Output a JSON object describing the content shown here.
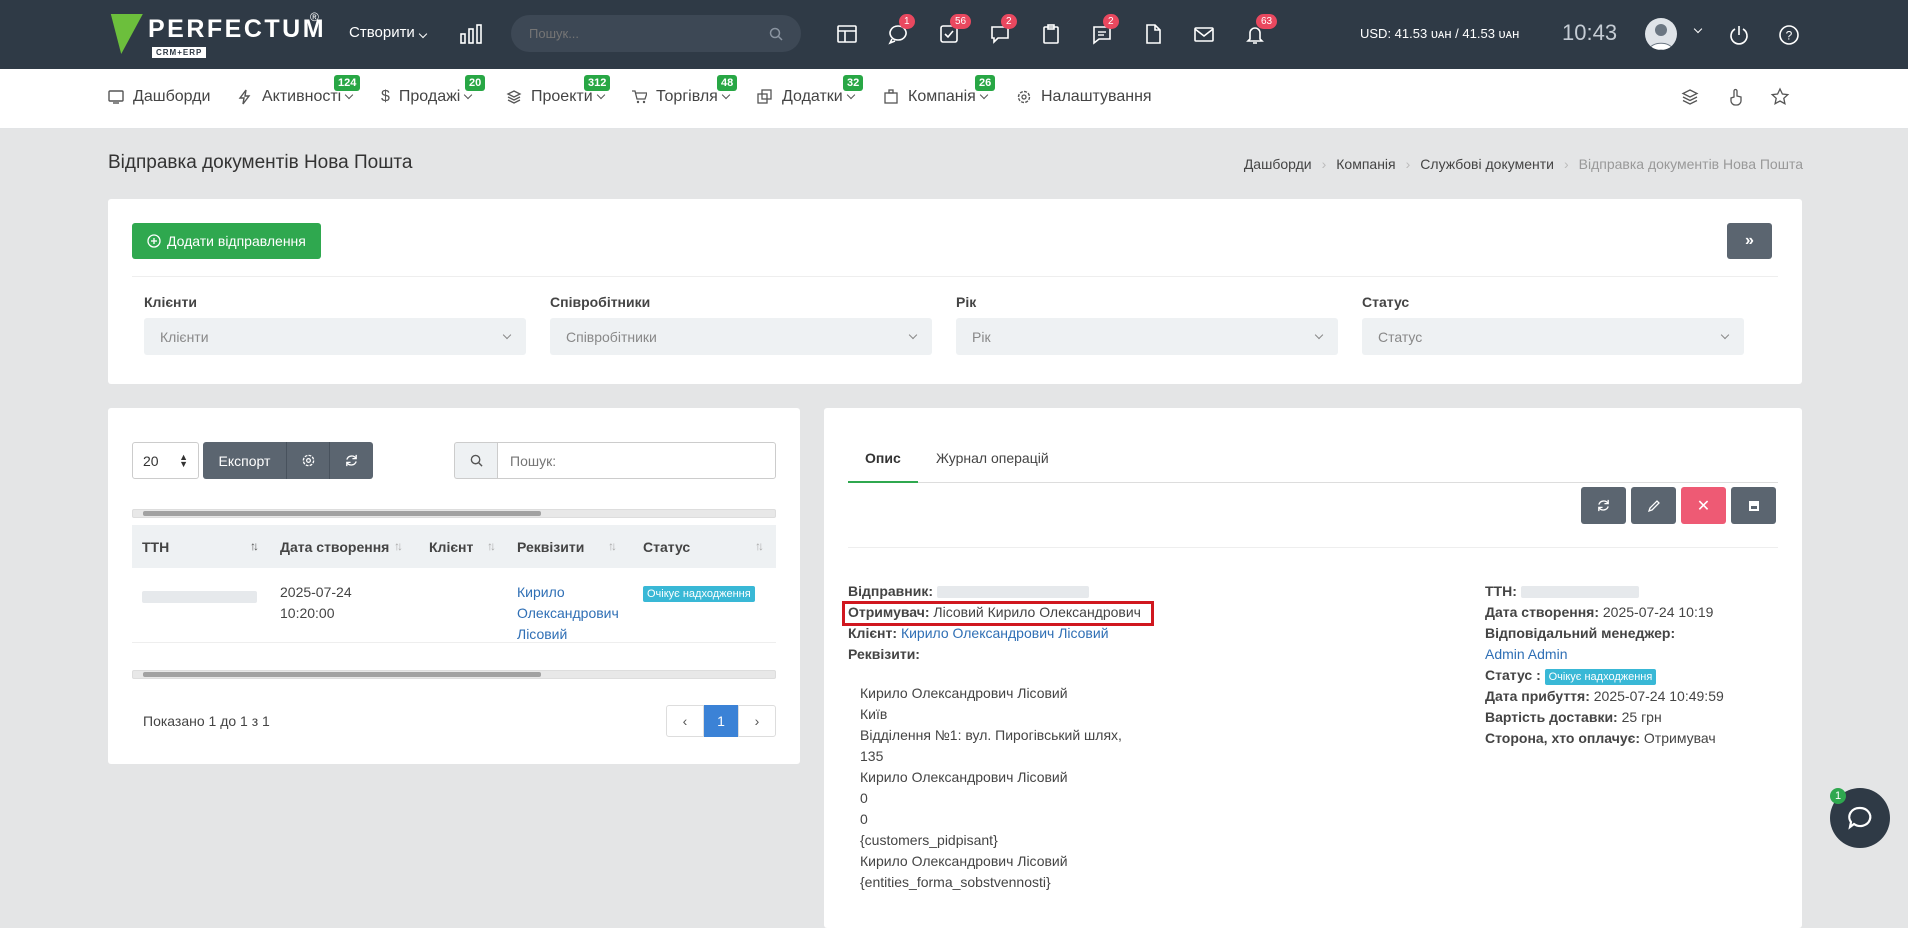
{
  "topbar": {
    "logo_text": "PERFECTUM",
    "logo_sub": "CRM+ERP",
    "create_label": "Створити",
    "search_placeholder": "Пошук...",
    "badges": {
      "chat": "1",
      "tasks": "56",
      "messages": "2",
      "notes": "2",
      "bell": "63"
    },
    "currency": "USD: 41.53 ᴜᴀʜ / 41.53 ᴜᴀʜ",
    "time": "10:43"
  },
  "menu": {
    "items": [
      {
        "label": "Дашборди",
        "badge": ""
      },
      {
        "label": "Активності",
        "badge": "124"
      },
      {
        "label": "Продажі",
        "badge": "20"
      },
      {
        "label": "Проекти",
        "badge": "312"
      },
      {
        "label": "Торгівля",
        "badge": "48"
      },
      {
        "label": "Додатки",
        "badge": "32"
      },
      {
        "label": "Компанія",
        "badge": "26"
      },
      {
        "label": "Налаштування",
        "badge": ""
      }
    ]
  },
  "page": {
    "title": "Відправка документів Нова Пошта",
    "breadcrumb": [
      "Дашборди",
      "Компанія",
      "Службові документи",
      "Відправка документів Нова Пошта"
    ]
  },
  "filters": {
    "add_button": "Додати відправлення",
    "toggle_button": "»",
    "fields": [
      {
        "label": "Клієнти",
        "placeholder": "Клієнти"
      },
      {
        "label": "Співробітники",
        "placeholder": "Співробітники"
      },
      {
        "label": "Рік",
        "placeholder": "Рік"
      },
      {
        "label": "Статус",
        "placeholder": "Статус"
      }
    ]
  },
  "list": {
    "page_size": "20",
    "export_label": "Експорт",
    "search_placeholder": "Пошук:",
    "columns": [
      "ТТН",
      "Дата створення",
      "Клієнт",
      "Реквізити",
      "Статус"
    ],
    "rows": [
      {
        "date_line1": "2025-07-24",
        "date_line2": "10:20:00",
        "client": "",
        "req_line1": "Кирило",
        "req_line2": "Олександрович",
        "req_line3": "Лісовий",
        "status": "Очікує надходження"
      }
    ],
    "shown_text": "Показано 1 до 1 з 1",
    "current_page": "1"
  },
  "detail": {
    "tabs": [
      "Опис",
      "Журнал операцій"
    ],
    "sender_label": "Відправник:",
    "recipient_label": "Отримувач:",
    "recipient_value": "Лісовий Кирило Олександрович",
    "client_label": "Клієнт:",
    "client_value": "Кирило Олександрович Лісовий",
    "requisites_label": "Реквізити:",
    "requisites_lines": [
      "Кирило Олександрович Лісовий",
      "Київ",
      "Відділення №1: вул. Пирогівський шлях,",
      "135",
      "Кирило Олександрович Лісовий",
      "0",
      "0",
      "{customers_pidpisant}",
      "Кирило Олександрович Лісовий",
      "{entities_forma_sobstvennosti}"
    ],
    "ttn_label": "ТТН:",
    "created_label": "Дата створення:",
    "created_value": "2025-07-24 10:19",
    "manager_label": "Відповідальний менеджер:",
    "manager_value": "Admin Admin",
    "status_label": "Статус :",
    "status_value": "Очікує надходження",
    "arrival_label": "Дата прибуття:",
    "arrival_value": "2025-07-24 10:49:59",
    "cost_label": "Вартість доставки:",
    "cost_value": "25 грн",
    "payer_label": "Сторона, хто оплачує:",
    "payer_value": "Отримувач"
  },
  "chat": {
    "badge": "1"
  },
  "colors": {
    "topbar": "#2f3a46",
    "accent_green": "#2fa84f",
    "badge_red": "#e9485f",
    "status_blue": "#39b8d6",
    "highlight": "#d0171f"
  }
}
